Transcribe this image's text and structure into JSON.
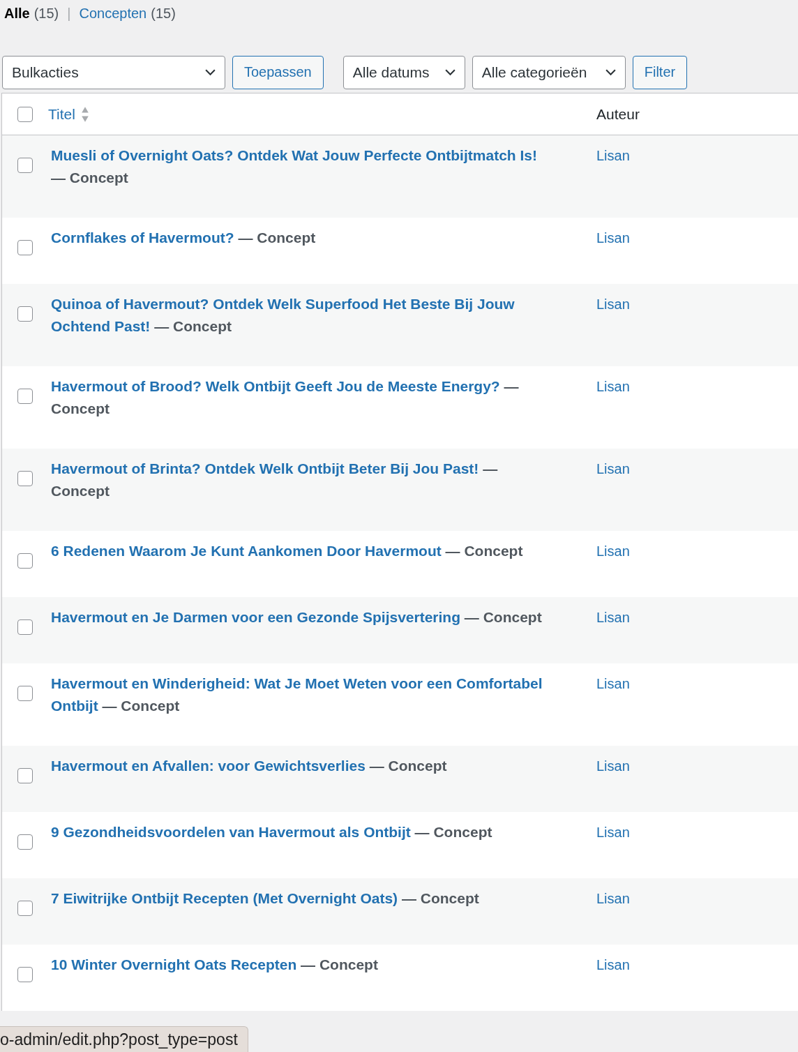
{
  "views": [
    {
      "label": "Alle",
      "count": "(15)",
      "selected": true
    },
    {
      "label": "Concepten",
      "count": "(15)",
      "selected": false
    }
  ],
  "separator": "|",
  "toolbar": {
    "bulk_actions": "Bulkacties",
    "apply": "Toepassen",
    "dates": "Alle datums",
    "categories": "Alle categorieën",
    "filter": "Filter"
  },
  "table": {
    "columns": [
      "Titel",
      "Auteur"
    ],
    "select_all": {
      "checked": false
    },
    "rows": [
      {
        "title": "Muesli of Overnight Oats? Ontdek Wat Jouw Perfecte Ontbijtmatch Is!",
        "state": "— Concept",
        "author": "Lisan",
        "checked": false
      },
      {
        "title": "Cornflakes of Havermout?",
        "state": "— Concept",
        "author": "Lisan",
        "checked": false
      },
      {
        "title": "Quinoa of Havermout? Ontdek Welk Superfood Het Beste Bij Jouw Ochtend Past!",
        "state": "— Concept",
        "author": "Lisan",
        "checked": false
      },
      {
        "title": "Havermout of Brood? Welk Ontbijt Geeft Jou de Meeste Energy?",
        "state": "— Concept",
        "author": "Lisan",
        "checked": false
      },
      {
        "title": "Havermout of Brinta? Ontdek Welk Ontbijt Beter Bij Jou Past!",
        "state": "— Concept",
        "author": "Lisan",
        "checked": false
      },
      {
        "title": "6 Redenen Waarom Je Kunt Aankomen Door Havermout",
        "state": "— Concept",
        "author": "Lisan",
        "checked": false
      },
      {
        "title": "Havermout en Je Darmen voor een Gezonde Spijsvertering",
        "state": "— Concept",
        "author": "Lisan",
        "checked": false
      },
      {
        "title": "Havermout en Winderigheid: Wat Je Moet Weten voor een Comfortabel Ontbijt",
        "state": "— Concept",
        "author": "Lisan",
        "checked": false
      },
      {
        "title": "Havermout en Afvallen: voor Gewichtsverlies",
        "state": "— Concept",
        "author": "Lisan",
        "checked": false
      },
      {
        "title": "9 Gezondheidsvoordelen van Havermout als Ontbijt",
        "state": "— Concept",
        "author": "Lisan",
        "checked": false
      },
      {
        "title": "7 Eiwitrijke Ontbijt Recepten (Met Overnight Oats)",
        "state": "— Concept",
        "author": "Lisan",
        "checked": false
      },
      {
        "title": "10 Winter Overnight Oats Recepten",
        "state": "— Concept",
        "author": "Lisan",
        "checked": false
      }
    ]
  },
  "status_bar": {
    "url": "o-admin/edit.php?post_type=post"
  }
}
